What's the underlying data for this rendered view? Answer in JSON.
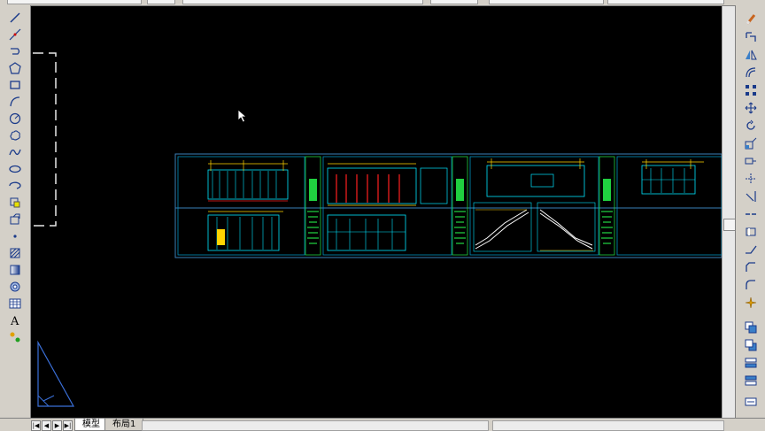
{
  "layout_tabs": [
    {
      "label": "模型",
      "active": true
    },
    {
      "label": "布局1",
      "active": false
    }
  ],
  "left_toolbar": [
    {
      "name": "line-icon"
    },
    {
      "name": "construction-line-icon"
    },
    {
      "name": "polyline-icon"
    },
    {
      "name": "polygon-icon"
    },
    {
      "name": "rectangle-icon"
    },
    {
      "name": "arc-icon"
    },
    {
      "name": "circle-icon"
    },
    {
      "name": "revision-cloud-icon"
    },
    {
      "name": "spline-icon"
    },
    {
      "name": "ellipse-icon"
    },
    {
      "name": "ellipse-arc-icon"
    },
    {
      "name": "insert-block-icon"
    },
    {
      "name": "make-block-icon"
    },
    {
      "name": "point-icon"
    },
    {
      "name": "hatch-icon"
    },
    {
      "name": "gradient-icon"
    },
    {
      "name": "region-icon"
    },
    {
      "name": "table-icon"
    },
    {
      "name": "multiline-text-icon"
    },
    {
      "name": "add-selected-icon"
    }
  ],
  "right_toolbar": [
    {
      "name": "erase-icon"
    },
    {
      "name": "copy-icon"
    },
    {
      "name": "mirror-icon"
    },
    {
      "name": "offset-icon"
    },
    {
      "name": "array-icon"
    },
    {
      "name": "move-icon"
    },
    {
      "name": "rotate-icon"
    },
    {
      "name": "scale-icon"
    },
    {
      "name": "stretch-icon"
    },
    {
      "name": "trim-icon"
    },
    {
      "name": "extend-icon"
    },
    {
      "name": "break-at-point-icon"
    },
    {
      "name": "break-icon"
    },
    {
      "name": "join-icon"
    },
    {
      "name": "chamfer-icon"
    },
    {
      "name": "fillet-icon"
    },
    {
      "name": "explode-icon"
    },
    {
      "name": "draworder-front-icon"
    },
    {
      "name": "draworder-back-icon"
    },
    {
      "name": "draworder-above-icon"
    },
    {
      "name": "draworder-under-icon"
    }
  ],
  "colors": {
    "canvas": "#000000",
    "drawing_cyan": "#00e5ff",
    "drawing_yellow": "#ffd400",
    "drawing_red": "#ff2020",
    "drawing_green": "#20d040",
    "sheet_border": "#3a7fb8"
  }
}
